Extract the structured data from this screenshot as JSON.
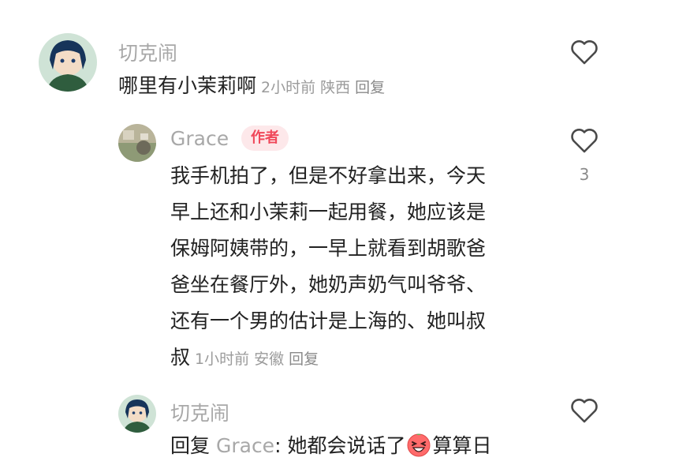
{
  "comments": [
    {
      "username": "切克闹",
      "text": "哪里有小茉莉啊",
      "time": "2小时前",
      "location": "陕西",
      "reply_label": "回复",
      "like_icon": "heart-outline-icon"
    },
    {
      "username": "Grace",
      "badge": "作者",
      "text_lines": [
        "我手机拍了，但是不好拿出来，今天",
        "早上还和小茉莉一起用餐，她应该是",
        "保姆阿姨带的，一早上就看到胡歌爸",
        "爸坐在餐厅外，她奶声奶气叫爷爷、",
        "还有一个男的估计是上海的、她叫叔",
        "叔"
      ],
      "time": "1小时前",
      "location": "安徽",
      "reply_label": "回复",
      "like_count": "3",
      "like_icon": "heart-outline-icon"
    },
    {
      "username": "切克闹",
      "reply_prefix": "回复",
      "reply_to": "Grace",
      "reply_colon": ":",
      "text_before_emoji": " 她都会说话了",
      "emoji": "laughing-face-emoji",
      "text_after_emoji": "算算日",
      "like_icon": "heart-outline-icon"
    }
  ],
  "colors": {
    "username": "#a8a8a8",
    "body_text": "#222222",
    "meta": "#9b9b9b",
    "badge_bg": "#fde8ea",
    "badge_text": "#f0485a"
  }
}
